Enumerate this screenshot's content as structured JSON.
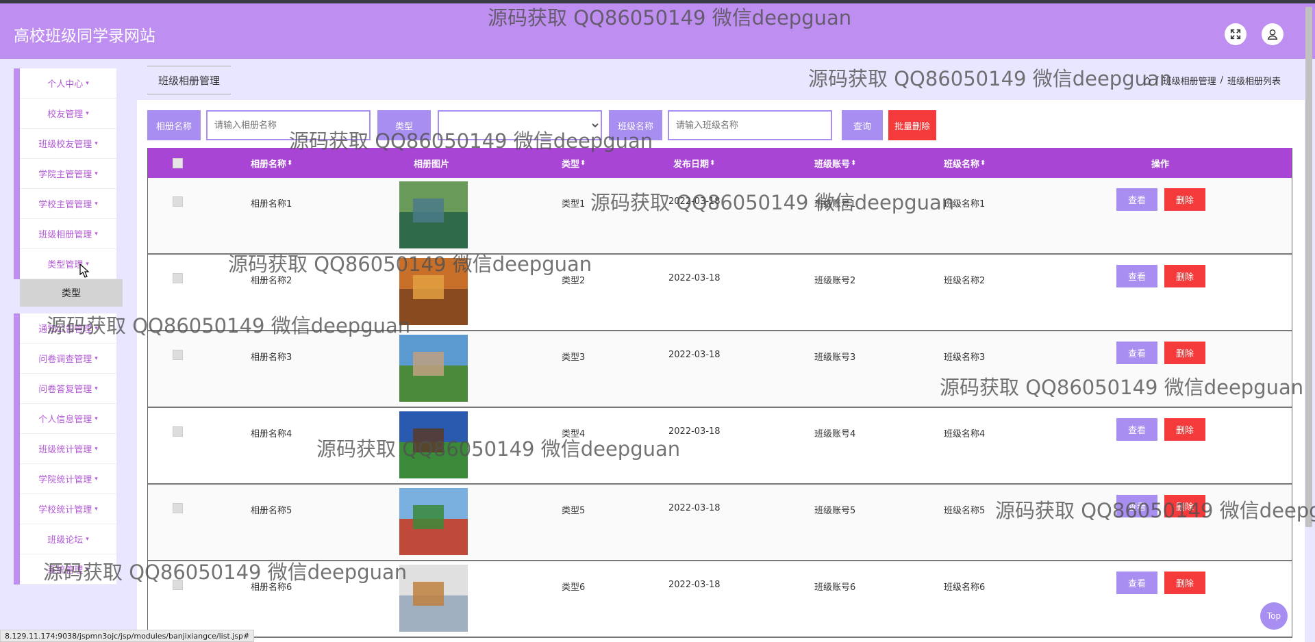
{
  "header": {
    "title": "高校班级同学录网站"
  },
  "sidebar": {
    "group1": [
      {
        "label": "个人中心"
      },
      {
        "label": "校友管理"
      },
      {
        "label": "班级校友管理"
      },
      {
        "label": "学院主管管理"
      },
      {
        "label": "学校主管管理"
      },
      {
        "label": "班级相册管理"
      },
      {
        "label": "类型管理"
      }
    ],
    "submenu_label": "类型",
    "group2": [
      {
        "label": "通知公告管理"
      },
      {
        "label": "问卷调查管理"
      },
      {
        "label": "问卷答复管理"
      },
      {
        "label": "个人信息管理"
      },
      {
        "label": "班级统计管理"
      },
      {
        "label": "学院统计管理"
      },
      {
        "label": "学校统计管理"
      },
      {
        "label": "班级论坛"
      },
      {
        "label": "系统管理"
      }
    ]
  },
  "tab": {
    "label": "班级相册管理"
  },
  "breadcrumb": {
    "sep": "/",
    "item1": "班级相册管理",
    "item2": "班级相册列表"
  },
  "search": {
    "name_label": "相册名称",
    "name_placeholder": "请输入相册名称",
    "type_label": "类型",
    "type_value": "",
    "class_label": "班级名称",
    "class_placeholder": "请输入班级名称",
    "query_label": "查询",
    "batch_delete_label": "批量删除"
  },
  "table": {
    "headers": {
      "name": "相册名称",
      "image": "相册图片",
      "type": "类型",
      "date": "发布日期",
      "account": "班级账号",
      "class_name": "班级名称",
      "ops": "操作"
    },
    "sort_glyph": "⬍",
    "view_label": "查看",
    "delete_label": "删除",
    "rows": [
      {
        "name": "相册名称1",
        "type": "类型1",
        "date": "2022-03-18",
        "account": "班级账号1",
        "class_name": "班级名称1"
      },
      {
        "name": "相册名称2",
        "type": "类型2",
        "date": "2022-03-18",
        "account": "班级账号2",
        "class_name": "班级名称2"
      },
      {
        "name": "相册名称3",
        "type": "类型3",
        "date": "2022-03-18",
        "account": "班级账号3",
        "class_name": "班级名称3"
      },
      {
        "name": "相册名称4",
        "type": "类型4",
        "date": "2022-03-18",
        "account": "班级账号4",
        "class_name": "班级名称4"
      },
      {
        "name": "相册名称5",
        "type": "类型5",
        "date": "2022-03-18",
        "account": "班级账号5",
        "class_name": "班级名称5"
      },
      {
        "name": "相册名称6",
        "type": "类型6",
        "date": "2022-03-18",
        "account": "班级账号6",
        "class_name": "班级名称6"
      }
    ]
  },
  "top_button": "Top",
  "statusbar": "8.129.11.174:9038/jspmn3ojc/jsp/modules/banjixiangce/list.jsp#",
  "watermark": "源码获取 QQ86050149 微信deepguan",
  "colors": {
    "header": "#be8ef0",
    "accent": "#a78ef0",
    "table_header": "#a845d4",
    "danger": "#f43a3a",
    "menu_text": "#b35bd6"
  },
  "icons": [
    "fullscreen-icon",
    "user-icon",
    "home-icon",
    "caret-down-icon",
    "cursor-icon"
  ]
}
